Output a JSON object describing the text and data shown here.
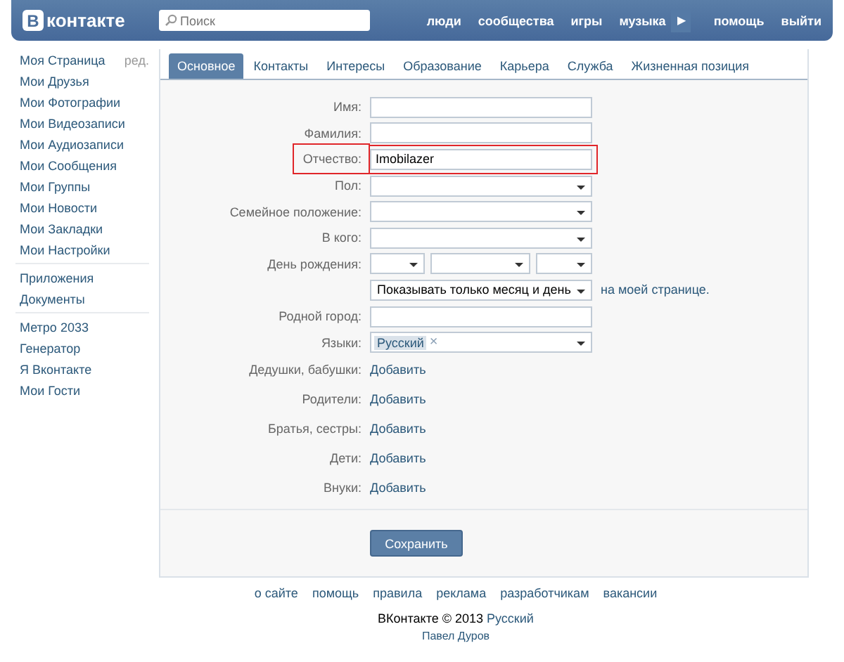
{
  "header": {
    "logo_letter": "В",
    "logo_text": "контакте",
    "search": {
      "placeholder": "Поиск"
    },
    "nav": [
      {
        "label": "люди",
        "kind": "link"
      },
      {
        "label": "сообщества",
        "kind": "link"
      },
      {
        "label": "игры",
        "kind": "link"
      },
      {
        "label": "музыка",
        "kind": "link"
      },
      {
        "label": "▶",
        "kind": "play"
      },
      {
        "label": "помощь",
        "kind": "link"
      },
      {
        "label": "выйти",
        "kind": "link"
      }
    ]
  },
  "sidebar": {
    "edit_link": "ред.",
    "groups": [
      [
        "Моя Страница",
        "Мои Друзья",
        "Мои Фотографии",
        "Мои Видеозаписи",
        "Мои Аудиозаписи",
        "Мои Сообщения",
        "Мои Группы",
        "Мои Новости",
        "Мои Закладки",
        "Мои Настройки"
      ],
      [
        "Приложения",
        "Документы"
      ],
      [
        "Метро 2033",
        "Генератор",
        "Я Вконтакте",
        "Мои Гости"
      ]
    ]
  },
  "tabs": [
    {
      "label": "Основное",
      "selected": true
    },
    {
      "label": "Контакты",
      "selected": false
    },
    {
      "label": "Интересы",
      "selected": false
    },
    {
      "label": "Образование",
      "selected": false
    },
    {
      "label": "Карьера",
      "selected": false
    },
    {
      "label": "Служба",
      "selected": false
    },
    {
      "label": "Жизненная позиция",
      "selected": false
    }
  ],
  "form": {
    "rows": [
      {
        "kind": "text",
        "label": "Имя:",
        "highlighted": false
      },
      {
        "kind": "text",
        "label": "Фамилия:",
        "highlighted": false
      },
      {
        "kind": "text",
        "label": "Отчество:",
        "value": "Imobilazer",
        "highlighted": true
      },
      {
        "kind": "select",
        "label": "Пол:"
      },
      {
        "kind": "select",
        "label": "Семейное положение:"
      },
      {
        "kind": "select",
        "label": "В кого:"
      },
      {
        "kind": "date",
        "label": "День рождения:"
      },
      {
        "kind": "privacy",
        "value": "Показывать только месяц и день",
        "note": "на моей странице."
      },
      {
        "kind": "text",
        "label": "Родной город:",
        "highlighted": false
      },
      {
        "kind": "tags",
        "label": "Языки:",
        "tags": [
          {
            "label": "Русский",
            "remove": "×"
          }
        ]
      },
      {
        "kind": "add",
        "label": "Дедушки, бабушки:",
        "link": "Добавить"
      },
      {
        "kind": "add",
        "label": "Родители:",
        "link": "Добавить"
      },
      {
        "kind": "add",
        "label": "Братья, сестры:",
        "link": "Добавить"
      },
      {
        "kind": "add",
        "label": "Дети:",
        "link": "Добавить"
      },
      {
        "kind": "add",
        "label": "Внуки:",
        "link": "Добавить"
      }
    ],
    "save_button": "Сохранить"
  },
  "footer": {
    "links": [
      "о сайте",
      "помощь",
      "правила",
      "реклама",
      "разработчикам",
      "вакансии"
    ],
    "copyright": "ВКонтакте © 2013",
    "language": "Русский",
    "author": "Павел Дуров"
  }
}
